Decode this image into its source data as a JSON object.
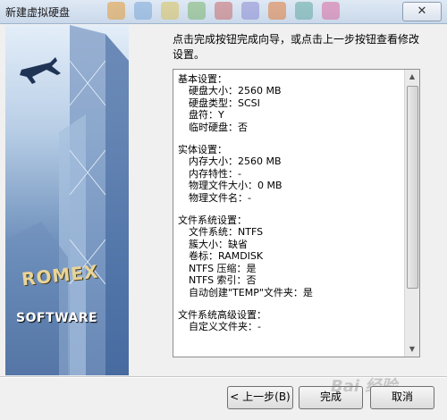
{
  "window": {
    "title": "新建虚拟硬盘",
    "close_glyph": "✕"
  },
  "banner": {
    "logo_brand": "ROMEX",
    "logo_sub": "SOFTWARE"
  },
  "intro": "点击完成按钮完成向导，或点击上一步按钮查看修改设置。",
  "summary": {
    "sections": [
      {
        "title": "基本设置：",
        "lines": [
          "硬盘大小：2560 MB",
          "硬盘类型：SCSI",
          "盘符：Y",
          "临时硬盘：否"
        ]
      },
      {
        "title": "实体设置：",
        "lines": [
          "内存大小：2560 MB",
          "内存特性：-",
          "物理文件大小：0 MB",
          "物理文件名：-"
        ]
      },
      {
        "title": "文件系统设置：",
        "lines": [
          "文件系统：NTFS",
          "簇大小：缺省",
          "卷标：RAMDISK",
          "NTFS 压缩：是",
          "NTFS 索引：否",
          "自动创建\"TEMP\"文件夹：是"
        ]
      },
      {
        "title": "文件系统高级设置：",
        "lines": [
          "自定义文件夹：-"
        ]
      }
    ]
  },
  "buttons": {
    "back": "< 上一步(B)",
    "finish": "完成",
    "cancel": "取消"
  },
  "watermark": "Bai 经验"
}
